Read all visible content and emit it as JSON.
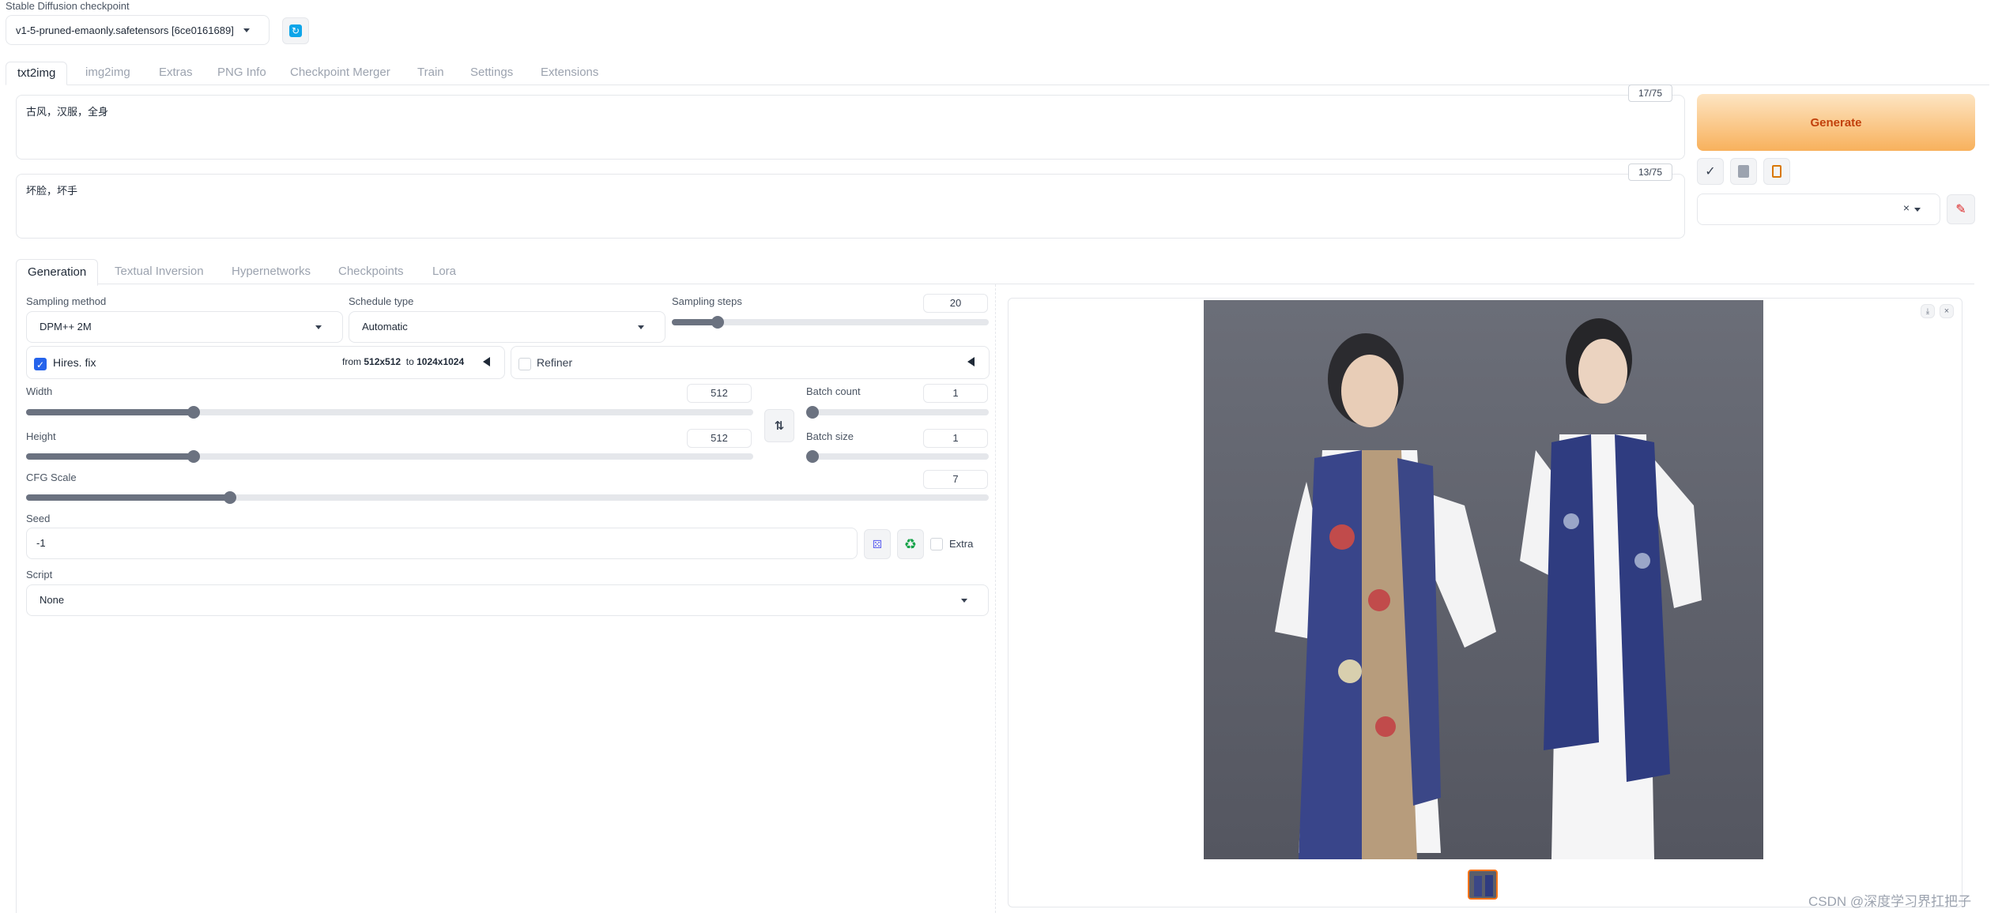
{
  "checkpoint": {
    "label": "Stable Diffusion checkpoint",
    "value": "v1-5-pruned-emaonly.safetensors [6ce0161689]"
  },
  "main_tabs": [
    "txt2img",
    "img2img",
    "Extras",
    "PNG Info",
    "Checkpoint Merger",
    "Train",
    "Settings",
    "Extensions"
  ],
  "prompt": {
    "text": "古风，汉服，全身",
    "token_count": "17/75"
  },
  "negative_prompt": {
    "text": "坏脸，坏手",
    "token_count": "13/75"
  },
  "generate_label": "Generate",
  "sub_tabs": [
    "Generation",
    "Textual Inversion",
    "Hypernetworks",
    "Checkpoints",
    "Lora"
  ],
  "sampling": {
    "method_label": "Sampling method",
    "method_value": "DPM++ 2M",
    "schedule_label": "Schedule type",
    "schedule_value": "Automatic",
    "steps_label": "Sampling steps",
    "steps_value": "20",
    "steps_fraction": 0.133
  },
  "hires": {
    "label": "Hires. fix",
    "from_label": "from",
    "from_value": "512x512",
    "to_label": "to",
    "to_value": "1024x1024",
    "checked": true
  },
  "refiner": {
    "label": "Refiner",
    "checked": false
  },
  "width": {
    "label": "Width",
    "value": "512",
    "fraction": 0.229
  },
  "height": {
    "label": "Height",
    "value": "512",
    "fraction": 0.229
  },
  "batch_count": {
    "label": "Batch count",
    "value": "1",
    "fraction": 0.0
  },
  "batch_size": {
    "label": "Batch size",
    "value": "1",
    "fraction": 0.0
  },
  "cfg": {
    "label": "CFG Scale",
    "value": "7",
    "fraction": 0.211
  },
  "seed": {
    "label": "Seed",
    "value": "-1",
    "extra_label": "Extra"
  },
  "script": {
    "label": "Script",
    "value": "None"
  },
  "watermark": "CSDN @深度学习界扛把子",
  "colors": {
    "generate_from": "#fde5c3",
    "generate_to": "#f8b15c",
    "generate_text": "#c2410c",
    "checkbox_on": "#2563eb"
  }
}
